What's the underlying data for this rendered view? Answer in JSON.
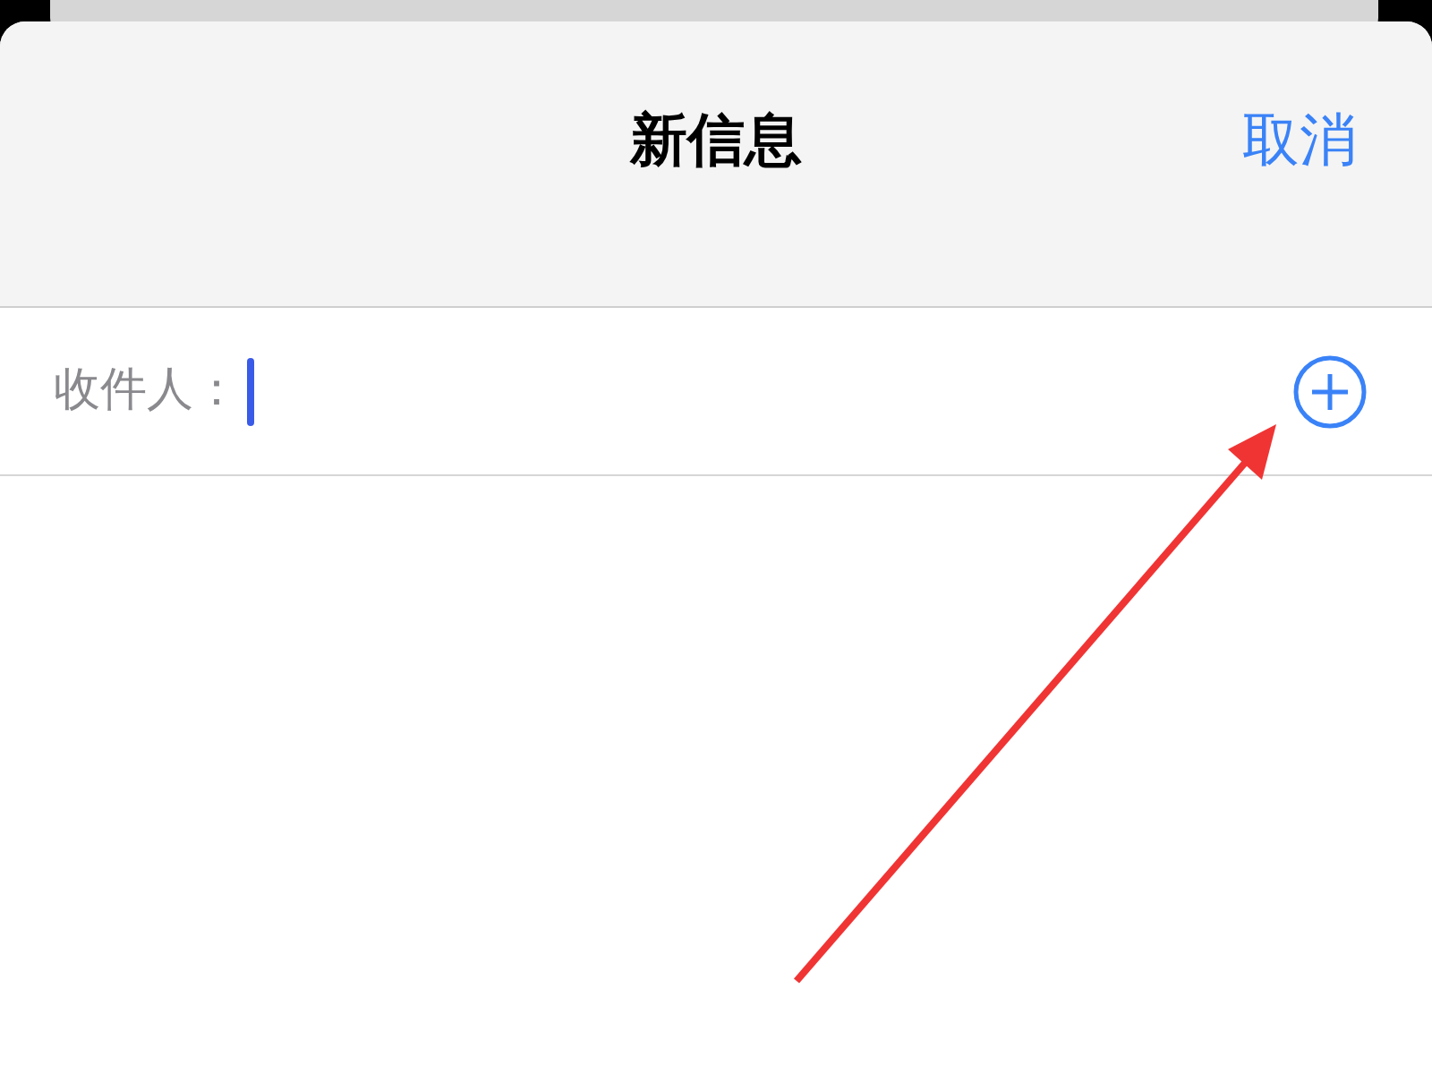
{
  "nav_bar": {
    "title": "新信息",
    "cancel": "取消"
  },
  "recipient_field": {
    "label": "收件人：",
    "focused": true
  }
}
